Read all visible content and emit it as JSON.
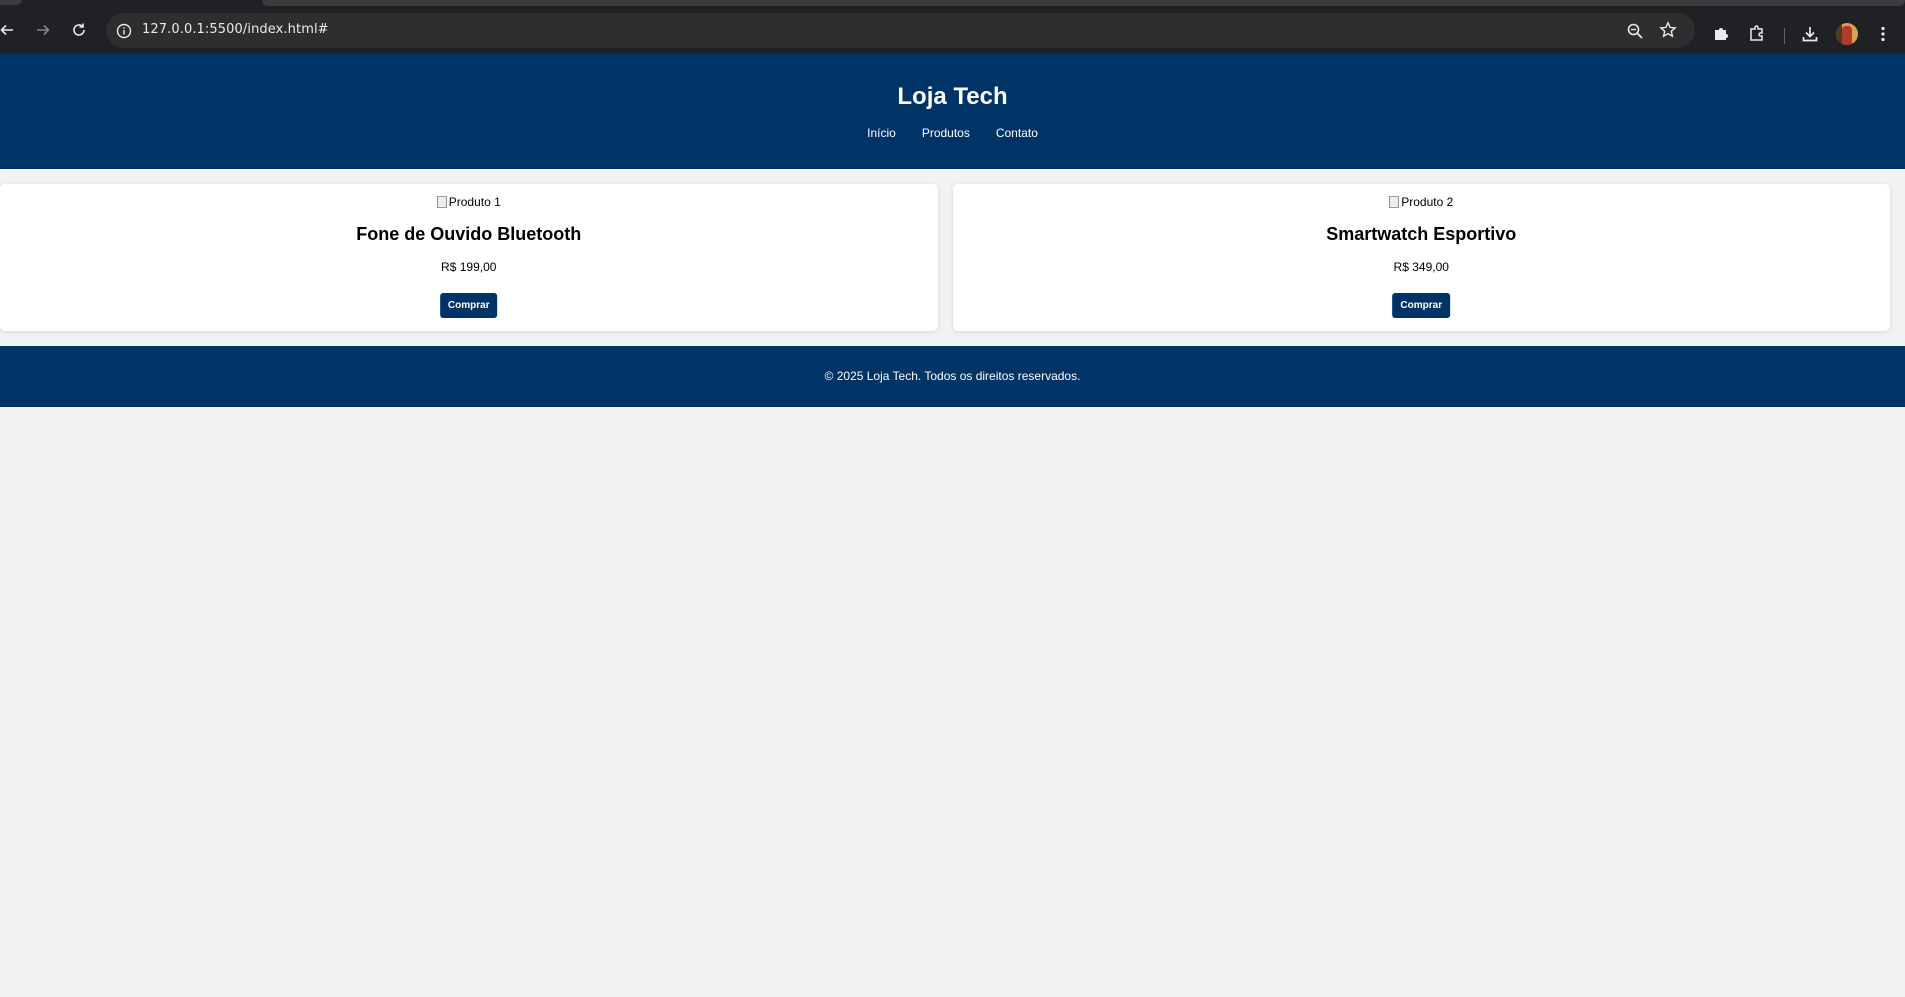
{
  "browser": {
    "url": "127.0.0.1:5500/index.html#",
    "icons": [
      "back-icon",
      "forward-icon",
      "reload-icon",
      "site-info-icon",
      "zoom-icon",
      "bookmark-star-icon",
      "extension-puzzle-piece-icon",
      "extensions-icon",
      "download-icon",
      "avatar",
      "menu-kebab-icon"
    ]
  },
  "header": {
    "title": "Loja Tech",
    "nav": [
      {
        "label": "Início"
      },
      {
        "label": "Produtos"
      },
      {
        "label": "Contato"
      }
    ]
  },
  "products": [
    {
      "image_alt": "Produto 1",
      "name": "Fone de Ouvido Bluetooth",
      "price": "R$ 199,00",
      "button": "Comprar"
    },
    {
      "image_alt": "Produto 2",
      "name": "Smartwatch Esportivo",
      "price": "R$ 349,00",
      "button": "Comprar"
    }
  ],
  "footer": {
    "text": "© 2025 Loja Tech. Todos os direitos reservados."
  },
  "colors": {
    "brand": "#003366",
    "page_bg": "#f2f2f2",
    "card_bg": "#ffffff"
  }
}
